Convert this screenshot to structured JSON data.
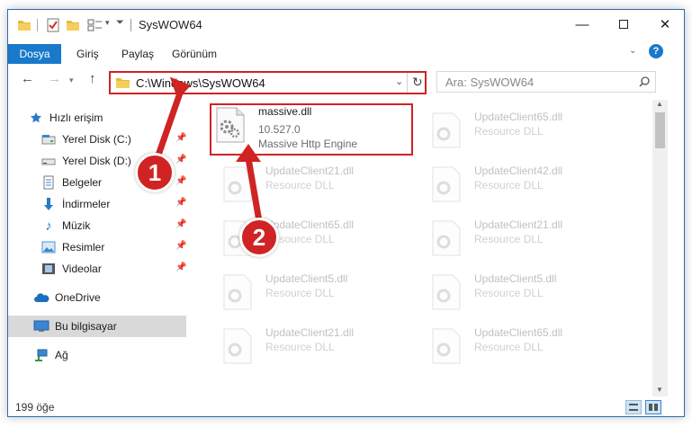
{
  "window": {
    "title": "SysWOW64"
  },
  "ribbon": {
    "tabs": [
      "Dosya",
      "Giriş",
      "Paylaş",
      "Görünüm"
    ]
  },
  "address": {
    "path": "C:\\Windows\\SysWOW64"
  },
  "search": {
    "placeholder": "Ara: SysWOW64"
  },
  "sidebar": {
    "items": [
      {
        "label": "Hızlı erişim",
        "icon": "star-icon",
        "pinned": false
      },
      {
        "label": "Yerel Disk (C:)",
        "icon": "drive-icon",
        "pinned": true
      },
      {
        "label": "Yerel Disk (D:)",
        "icon": "drive-icon",
        "pinned": true
      },
      {
        "label": "Belgeler",
        "icon": "documents-icon",
        "pinned": true
      },
      {
        "label": "İndirmeler",
        "icon": "download-icon",
        "pinned": true
      },
      {
        "label": "Müzik",
        "icon": "music-icon",
        "pinned": true
      },
      {
        "label": "Resimler",
        "icon": "pictures-icon",
        "pinned": true
      },
      {
        "label": "Videolar",
        "icon": "video-icon",
        "pinned": true
      },
      {
        "label": "OneDrive",
        "icon": "cloud-icon",
        "pinned": false
      },
      {
        "label": "Bu bilgisayar",
        "icon": "computer-icon",
        "pinned": false
      },
      {
        "label": "Ağ",
        "icon": "network-icon",
        "pinned": false
      }
    ]
  },
  "files": {
    "highlighted": {
      "name": "massive.dll",
      "version": "10.527.0",
      "description": "Massive Http Engine"
    },
    "others": [
      {
        "name": "UpdateClient65.dll",
        "type": "Resource DLL"
      },
      {
        "name": "UpdateClient21.dll",
        "type": "Resource DLL"
      },
      {
        "name": "UpdateClient42.dll",
        "type": "Resource DLL"
      },
      {
        "name": "UpdateClient65.dll",
        "type": "Resource DLL"
      },
      {
        "name": "UpdateClient21.dll",
        "type": "Resource DLL"
      },
      {
        "name": "UpdateClient5.dll",
        "type": "Resource DLL"
      },
      {
        "name": "UpdateClient5.dll",
        "type": "Resource DLL"
      },
      {
        "name": "UpdateClient21.dll",
        "type": "Resource DLL"
      },
      {
        "name": "UpdateClient65.dll",
        "type": "Resource DLL"
      }
    ]
  },
  "status": {
    "count": "199 öğe"
  },
  "annotations": {
    "step1": "1",
    "step2": "2"
  },
  "colors": {
    "accent": "#1979ca",
    "annotation": "#d02323",
    "selected": "#d9d9d9"
  }
}
